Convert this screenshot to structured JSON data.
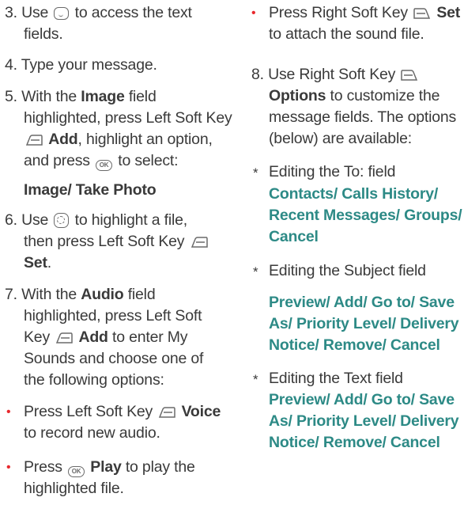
{
  "left": {
    "step3": {
      "pre": "3. Use",
      "post": "to access the text",
      "cont": "fields."
    },
    "step4": "4. Type your message.",
    "step5": {
      "l1_pre": "5. With the",
      "l1_bold": "Image",
      "l1_post": "field",
      "l2": "highlighted, press Left Soft Key",
      "l3_bold": "Add",
      "l3_post": ", highlight an option,",
      "l4_pre": "and press",
      "l4_post": "to select:",
      "options": "Image/ Take Photo"
    },
    "step6": {
      "l1_pre": "6. Use",
      "l1_post": "to highlight a file,",
      "l2": "then press Left Soft Key",
      "l3_bold": "Set",
      "l3_post": "."
    },
    "step7": {
      "l1_pre": "7. With the",
      "l1_bold": "Audio",
      "l1_post": "field",
      "l2": "highlighted, press Left Soft",
      "l3_pre": "Key",
      "l3_bold": "Add",
      "l3_post": "to enter My",
      "l4": "Sounds and choose one of",
      "l5": "the following options:"
    },
    "bullet1": {
      "pre": "Press Left Soft Key",
      "bold": "Voice",
      "cont": "to record new audio."
    },
    "bullet2": {
      "pre": "Press",
      "bold": "Play",
      "post": "to play the",
      "cont": "highlighted file."
    }
  },
  "right": {
    "bullet3": {
      "pre": "Press Right Soft Key",
      "bold": "Set",
      "cont": "to attach the sound file."
    },
    "step8": {
      "l1": "8. Use Right Soft Key",
      "l2_bold": "Options",
      "l2_post": "to customize the",
      "l3": "message fields. The options",
      "l4": "(below) are available:"
    },
    "sub1": {
      "label": "Editing the To: field",
      "o1": "Contacts/ Calls History/",
      "o2": "Recent Messages/ Groups/",
      "o3": "Cancel"
    },
    "sub2": {
      "label": "Editing the Subject field",
      "o1": "Preview/ Add/ Go to/ Save",
      "o2": "As/ Priority Level/ Delivery",
      "o3": "Notice/ Remove/ Cancel"
    },
    "sub3": {
      "label": "Editing the Text field",
      "o1": "Preview/ Add/ Go to/ Save",
      "o2": "As/ Priority Level/ Delivery",
      "o3": "Notice/ Remove/ Cancel"
    },
    "star": "*",
    "bullet_char": "•"
  },
  "colors": {
    "accent_text": "#2d8a86",
    "bullet": "#e8282d",
    "body_text": "#3a3a3a"
  },
  "icons": [
    "directional-key-icon",
    "navigation-key-icon",
    "ok-key-icon",
    "left-soft-key-icon",
    "right-soft-key-icon"
  ]
}
